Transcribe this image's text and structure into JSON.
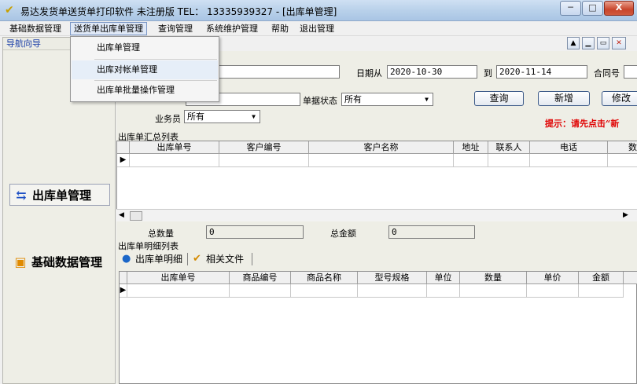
{
  "window": {
    "title": "易达发货单送货单打印软件 未注册版 TEL： 13335939327  - [出库单管理]",
    "min": "─",
    "max": "□",
    "close": "X"
  },
  "menu": {
    "items": [
      "基础数据管理",
      "送货单出库单管理",
      "查询管理",
      "系统维护管理",
      "帮助",
      "退出管理"
    ],
    "active": "送货单出库单管理"
  },
  "dropdown": {
    "items": [
      "出库单管理",
      "出库对帐单管理",
      "出库单批量操作管理"
    ]
  },
  "sidebar": {
    "header": "导航向导",
    "buttons": [
      "出库单管理",
      "基础数据管理"
    ],
    "icons": [
      "document-icon",
      "gift-icon"
    ]
  },
  "form": {
    "date_from_label": "日期从",
    "date_from": "2020-10-30",
    "date_to_label": "到",
    "date_to": "2020-11-14",
    "contract_label": "合同号",
    "status_label": "单据状态",
    "status_value": "所有",
    "staff_label": "业务员",
    "staff_value": "所有",
    "query_button": "查询",
    "add_button": "新增",
    "edit_button": "修改",
    "hint": "提示：请先点击“新"
  },
  "summary": {
    "section_label": "出库单汇总列表",
    "columns": [
      "出库单号",
      "客户编号",
      "客户名称",
      "地址",
      "联系人",
      "电话",
      "数"
    ],
    "total_qty_label": "总数量",
    "total_qty": "0",
    "total_amount_label": "总金额",
    "total_amount": "0"
  },
  "detail": {
    "section_label": "出库单明细列表",
    "tabs": [
      "出库单明细",
      "相关文件"
    ],
    "columns": [
      "出库单号",
      "商品编号",
      "商品名称",
      "型号规格",
      "单位",
      "数量",
      "单价",
      "金额"
    ]
  },
  "colors": {
    "hint": "#e00000",
    "sidebar_header": "#1a3ea8"
  }
}
